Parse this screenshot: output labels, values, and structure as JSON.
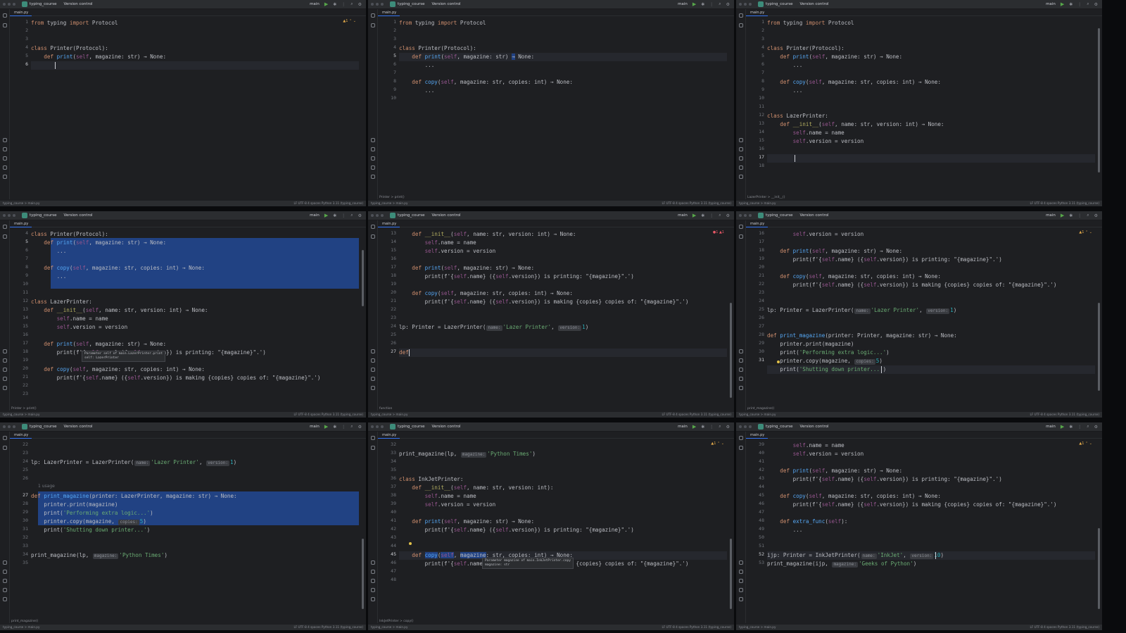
{
  "ui": {
    "project": "typing_course",
    "vcs": "Version control",
    "branch": "main",
    "tab": "main.py",
    "status_left": "typing_course > main.py",
    "status_right": "LF   UTF-8   4 spaces   Python 3.11 (typing_course)",
    "warnings": "▲1 ⌃ ⌄",
    "breadcrumb_1": "Printer > print()",
    "breadcrumb_2": "LazerPrinter > __init__()",
    "breadcrumb_3": "Printer > print()",
    "breadcrumb_4": "function",
    "breadcrumb_5": "print_magazine()",
    "breadcrumb_6": "print_magazine()",
    "breadcrumb_7": "InkJetPrinter > copy()",
    "usage_label": "1 usage"
  },
  "hints": {
    "self_hint_1": "Parameter self of main.LazerPrinter.print",
    "self_hint_2": "self: LazerPrinter",
    "mag_hint_1": "Parameter magazine of main.InkJetPrinter.copy",
    "mag_hint_2": "magazine: str"
  },
  "colors": {
    "editor_bg": "#1e1f22",
    "keyword": "#cf8e6d",
    "function": "#56a8f5",
    "string": "#6aab73",
    "self": "#94558d",
    "selection": "#214283"
  }
}
